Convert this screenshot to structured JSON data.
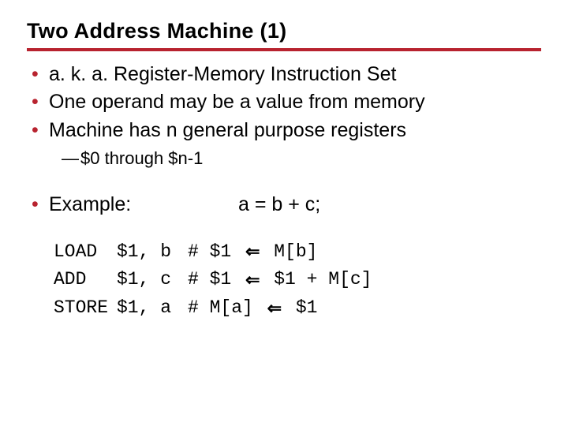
{
  "title": "Two Address Machine (1)",
  "bullets": {
    "b1": "a. k. a. Register-Memory Instruction Set",
    "b2": "One operand may be a value from memory",
    "b3": "Machine has n general purpose registers",
    "b3_sub": "$0 through $n-1",
    "b4_label": "Example:",
    "b4_expr": "a = b + c;"
  },
  "code": {
    "r1": {
      "op": "LOAD",
      "args": "$1, b",
      "c_pre": "# $1 ",
      "c_post": " M[b]"
    },
    "r2": {
      "op": "ADD",
      "args": "$1, c",
      "c_pre": "# $1 ",
      "c_post": " $1 + M[c]"
    },
    "r3": {
      "op": "STORE",
      "args": "$1, a",
      "c_pre": "# M[a] ",
      "c_post": " $1"
    }
  },
  "glyphs": {
    "left_arrow": "⇐"
  },
  "colors": {
    "accent": "#b8232f"
  }
}
